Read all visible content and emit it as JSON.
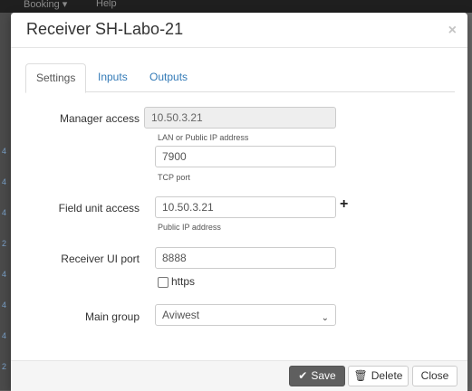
{
  "background": {
    "nav_items": [
      "Booking ▾",
      "Help"
    ]
  },
  "modal": {
    "title": "Receiver SH-Labo-21",
    "close_glyph": "×"
  },
  "tabs": [
    {
      "label": "Settings",
      "active": true
    },
    {
      "label": "Inputs",
      "active": false
    },
    {
      "label": "Outputs",
      "active": false
    }
  ],
  "form": {
    "manager_access": {
      "label": "Manager access",
      "address_value": "10.50.3.21",
      "address_help": "LAN or Public IP address",
      "port_value": "7900",
      "port_help": "TCP port"
    },
    "field_unit_access": {
      "label": "Field unit access",
      "value": "10.50.3.21",
      "help": "Public IP address",
      "add_icon": "plus-icon"
    },
    "receiver_ui_port": {
      "label": "Receiver UI port",
      "value": "8888",
      "https_label": "https",
      "https_checked": false
    },
    "main_group": {
      "label": "Main group",
      "selected": "Aviwest"
    }
  },
  "footer": {
    "save_label": "Save",
    "delete_label": "Delete",
    "close_label": "Close"
  },
  "colors": {
    "link": "#337ab7",
    "save_button": "#5f5f5f"
  }
}
